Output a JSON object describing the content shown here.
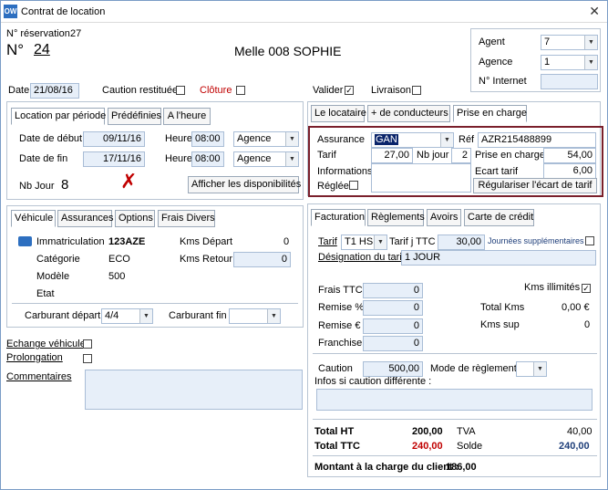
{
  "window": {
    "title": "Contrat de location",
    "icon": "OW"
  },
  "header": {
    "reservation_label": "N° réservation",
    "reservation_value": "27",
    "no_label": "N°",
    "no_value": "24",
    "client": "Melle 008 SOPHIE",
    "agent_label": "Agent",
    "agent_value": "7",
    "agence_label": "Agence",
    "agence_value": "1",
    "internet_label": "N° Internet",
    "internet_value": ""
  },
  "row2": {
    "date_label": "Date",
    "date_value": "21/08/16",
    "caution_label": "Caution restituée",
    "cloture_label": "Clôture",
    "valider_label": "Valider",
    "valider_mark": "✓",
    "livraison_label": "Livraison"
  },
  "period": {
    "tabs": [
      "Location par période",
      "Prédéfinies",
      "A l'heure"
    ],
    "debut_label": "Date de début",
    "debut_value": "09/11/16",
    "fin_label": "Date de fin",
    "fin_value": "17/11/16",
    "heure_label": "Heure",
    "heure1": "08:00",
    "heure2": "08:00",
    "lieu1": "Agence",
    "lieu2": "Agence",
    "nbjour_label": "Nb Jour",
    "nbjour_value": "8",
    "cross": "✗",
    "dispo_button": "Afficher les disponibilités"
  },
  "loc_tabs": [
    "Le locataire",
    "+ de conducteurs",
    "Prise en charge"
  ],
  "assurance": {
    "label": "Assurance",
    "value": "GAN",
    "ref_label": "Réf",
    "ref_value": "AZR215488899",
    "tarif_label": "Tarif",
    "tarif_value": "27,00",
    "nbjour_label": "Nb jour",
    "nbjour_value": "2",
    "prise_label": "Prise en charge",
    "prise_value": "54,00",
    "info_label": "Informations",
    "ecart_label": "Ecart tarif",
    "ecart_value": "6,00",
    "reglee_label": "Réglée",
    "regul_button": "Régulariser l'écart de tarif"
  },
  "vehicle": {
    "tabs": [
      "Véhicule",
      "Assurances",
      "Options",
      "Frais Divers"
    ],
    "immat_label": "Immatriculation",
    "immat_value": "123AZE",
    "cat_label": "Catégorie",
    "cat_value": "ECO",
    "modele_label": "Modèle",
    "modele_value": "500",
    "etat_label": "Etat",
    "kmsdep_label": "Kms Départ",
    "kmsdep_value": "0",
    "kmsret_label": "Kms Retour",
    "kmsret_value": "0",
    "carbdep_label": "Carburant départ",
    "carbdep_value": "4/4",
    "carbfin_label": "Carburant fin",
    "carbfin_value": ""
  },
  "misc": {
    "echange": "Echange véhicule",
    "prolongation": "Prolongation",
    "commentaires": "Commentaires"
  },
  "factu": {
    "tabs": [
      "Facturation",
      "Règlements",
      "Avoirs",
      "Carte de crédit"
    ],
    "tarif_label": "Tarif",
    "tarif_value": "T1 HS",
    "tarifj_label": "Tarif j TTC",
    "tarifj_value": "30,00",
    "journees_label": "Journées supplémentaires",
    "design_label": "Désignation du tarif",
    "design_value": "1 JOUR",
    "frais_label": "Frais TTC",
    "frais_value": "0",
    "remisep_label": "Remise %",
    "remisep_value": "0",
    "remisee_label": "Remise €",
    "remisee_value": "0",
    "franchise_label": "Franchise",
    "franchise_value": "0",
    "kmsill_label": "Kms illimités",
    "kmsill_mark": "✓",
    "totkms_label": "Total Kms",
    "totkms_value": "0,00 €",
    "kmssup_label": "Kms sup",
    "kmssup_value": "0",
    "caution_label": "Caution",
    "caution_value": "500,00",
    "mode_label": "Mode de règlement",
    "infos_label": "Infos si caution différente :"
  },
  "totals": {
    "ht_label": "Total HT",
    "ht_value": "200,00",
    "ttc_label": "Total TTC",
    "ttc_value": "240,00",
    "tva_label": "TVA",
    "tva_value": "40,00",
    "solde_label": "Solde",
    "solde_value": "240,00",
    "montant_label": "Montant à la charge du client :",
    "montant_value": "186,00"
  },
  "colors": {
    "highlight_border": "#7a1f2b",
    "red": "#c00000",
    "field_bg": "#e7eff9"
  }
}
